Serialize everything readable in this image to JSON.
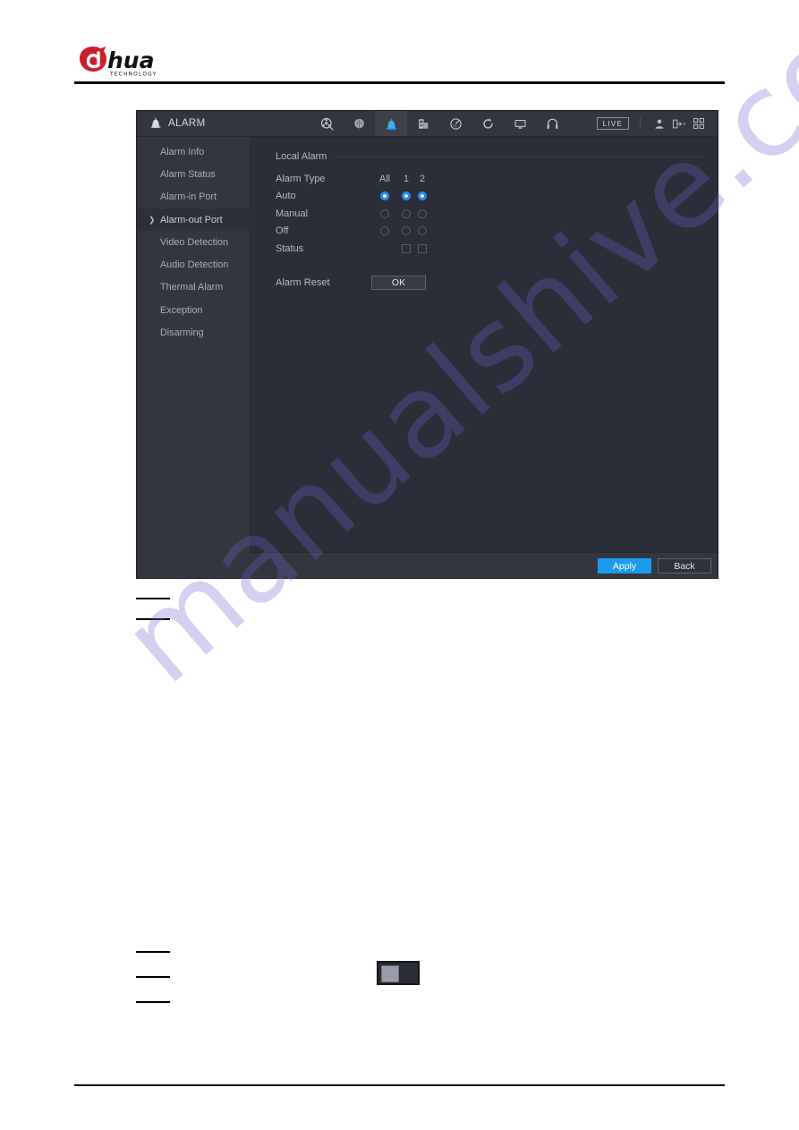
{
  "document": {
    "brand": {
      "name": "alhua",
      "wordmark_a": "a",
      "wordmark_rest": "hua",
      "tagline": "TECHNOLOGY"
    },
    "watermark": "manualshive.com"
  },
  "ui": {
    "header": {
      "title": "ALARM",
      "title_icon": "alarm-siren-icon",
      "nav_icons": [
        {
          "name": "search-disc-icon",
          "active": false
        },
        {
          "name": "ai-brain-icon",
          "active": false
        },
        {
          "name": "alarm-siren-icon",
          "active": true
        },
        {
          "name": "pos-device-icon",
          "active": false
        },
        {
          "name": "gauge-icon",
          "active": false
        },
        {
          "name": "sync-refresh-icon",
          "active": false
        },
        {
          "name": "monitor-icon",
          "active": false
        },
        {
          "name": "headphones-icon",
          "active": false
        }
      ],
      "live_label": "LIVE",
      "right_icons": [
        {
          "name": "user-account-icon"
        },
        {
          "name": "logout-dropdown-icon"
        },
        {
          "name": "grid-apps-icon"
        }
      ]
    },
    "sidebar": {
      "items": [
        {
          "label": "Alarm Info",
          "selected": false
        },
        {
          "label": "Alarm Status",
          "selected": false
        },
        {
          "label": "Alarm-in Port",
          "selected": false
        },
        {
          "label": "Alarm-out Port",
          "selected": true
        },
        {
          "label": "Video Detection",
          "selected": false
        },
        {
          "label": "Audio Detection",
          "selected": false
        },
        {
          "label": "Thermal Alarm",
          "selected": false
        },
        {
          "label": "Exception",
          "selected": false
        },
        {
          "label": "Disarming",
          "selected": false
        }
      ]
    },
    "main": {
      "section_title": "Local Alarm",
      "alarm_type_label": "Alarm Type",
      "columns": [
        "All",
        "1",
        "2"
      ],
      "rows": [
        {
          "label": "Auto",
          "control": "radio",
          "values": [
            true,
            true,
            true
          ]
        },
        {
          "label": "Manual",
          "control": "radio",
          "values": [
            false,
            false,
            false
          ]
        },
        {
          "label": "Off",
          "control": "radio",
          "values": [
            false,
            false,
            false
          ]
        },
        {
          "label": "Status",
          "control": "checkbox",
          "values": [
            null,
            false,
            false
          ]
        }
      ],
      "alarm_reset_label": "Alarm Reset",
      "ok_label": "OK"
    },
    "footer": {
      "apply_label": "Apply",
      "back_label": "Back"
    },
    "colors": {
      "accent_blue": "#1a9bf0",
      "panel_bg": "#2b2d38",
      "sidebar_bg": "#34363f"
    }
  }
}
